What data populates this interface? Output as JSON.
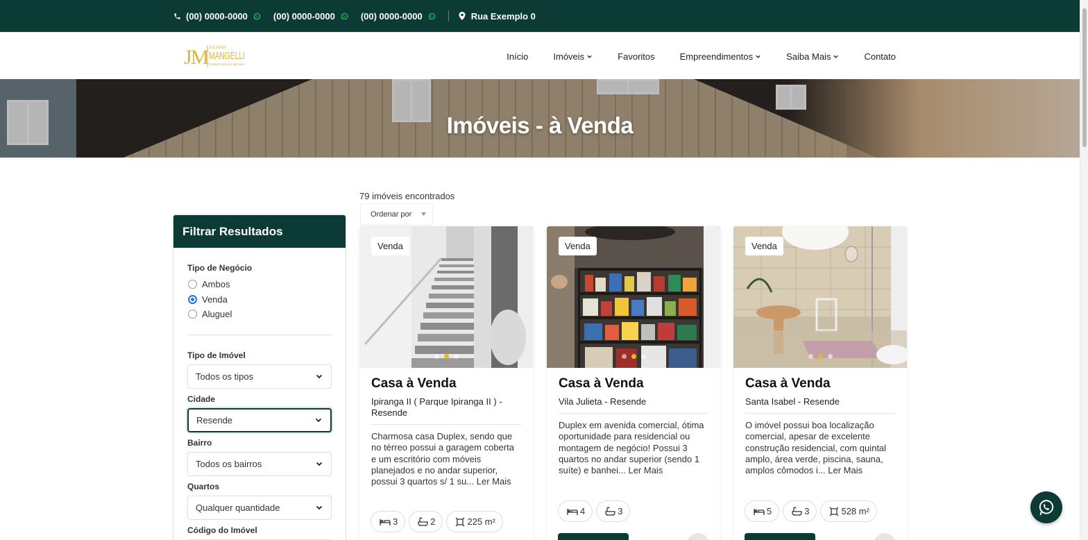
{
  "topbar": {
    "phones": [
      "(00) 0000-0000",
      "(00) 0000-0000",
      "(00) 0000-0000"
    ],
    "address": "Rua Exemplo 0"
  },
  "brand": {
    "monogram": "JM",
    "name_line1": "JULIANA",
    "name_line2": "MANGELLI",
    "tagline": "CORRETORA DE IMÓVEIS",
    "color": "#e0b53a"
  },
  "nav": {
    "items": [
      {
        "label": "Início"
      },
      {
        "label": "Imóveis"
      },
      {
        "label": "Favoritos"
      },
      {
        "label": "Empreendimentos"
      },
      {
        "label": "Saiba Mais"
      },
      {
        "label": "Contato"
      }
    ]
  },
  "hero": {
    "title": "Imóveis - à Venda"
  },
  "filters": {
    "title": "Filtrar Resultados",
    "business_type_label": "Tipo de Negócio",
    "business_options": [
      "Ambos",
      "Venda",
      "Aluguel"
    ],
    "business_selected": "Venda",
    "property_type_label": "Tipo de Imóvel",
    "property_type_value": "Todos os tipos",
    "city_label": "Cidade",
    "city_value": "Resende",
    "neighborhood_label": "Bairro",
    "neighborhood_value": "Todos os bairros",
    "rooms_label": "Quartos",
    "rooms_value": "Qualquer quantidade",
    "code_label": "Código do Imóvel"
  },
  "results": {
    "count_text": "79 imóveis encontrados",
    "sort_label": "Ordenar por"
  },
  "listings": [
    {
      "badge": "Venda",
      "title": "Casa à Venda",
      "location": "Ipiranga II ( Parque Ipiranga II ) - Resende",
      "description": "Charmosa casa Duplex, sendo que no térreo possui a garagem coberta e um escritório com móveis planejados e no andar superior, possui 3 quartos s/ 1 su...",
      "more": "Ler Mais",
      "beds": "3",
      "baths": "2",
      "area": "225 m²"
    },
    {
      "badge": "Venda",
      "title": "Casa à Venda",
      "location": "Vila Julieta - Resende",
      "description": "Duplex em avenida comercial, ótima oportunidade para residencial ou montagem de negócio! Possui 3 quartos no andar superior (sendo 1 suíte) e banhei...",
      "more": "Ler Mais",
      "beds": "4",
      "baths": "3",
      "area": ""
    },
    {
      "badge": "Venda",
      "title": "Casa à Venda",
      "location": "Santa Isabel - Resende",
      "description": "O imóvel possui boa localização comercial, apesar de excelente construção residencial, com quintal amplo, área verde, piscina, sauna, amplos cômodos i...",
      "more": "Ler Mais",
      "beds": "5",
      "baths": "3",
      "area": "528 m²"
    }
  ],
  "colors": {
    "primary": "#0b3b34",
    "accent": "#e8b62c",
    "whatsapp": "#25d366"
  }
}
